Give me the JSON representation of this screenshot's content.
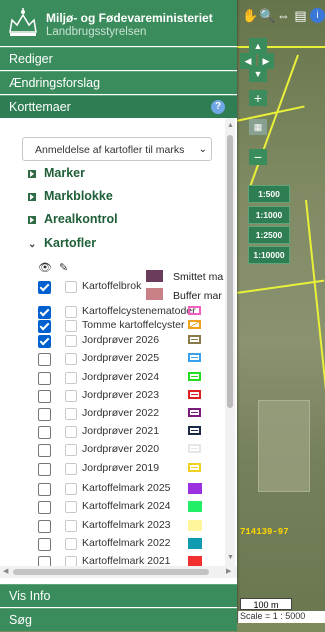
{
  "header": {
    "title": "Miljø- og Fødevareministeriet",
    "subtitle": "Landbrugsstyrelsen"
  },
  "tabs": {
    "rediger": "Rediger",
    "aendringsforslag": "Ændringsforslag",
    "korttemaer": "Korttemaer",
    "vis_info": "Vis Info",
    "soeg": "Søg"
  },
  "help_icon": "?",
  "selector": {
    "value": "Anmeldelse af kartofler til marks"
  },
  "groups": [
    "Marker",
    "Markblokke",
    "Arealkontrol",
    "Kartofler"
  ],
  "legend_popup": [
    {
      "label": "Smittet ma",
      "color": "#6a3d5c"
    },
    {
      "label": "Buffer mar",
      "color": "#c97f86"
    }
  ],
  "layers": [
    {
      "label": "Kartoffelbrok",
      "checked": true,
      "color": "",
      "style": "none"
    },
    {
      "label": "Kartoffelcystenematoder",
      "checked": true,
      "color": "#f25fc0",
      "style": "outline"
    },
    {
      "label": "Tomme kartoffelcyster",
      "checked": true,
      "color": "#f0a020",
      "style": "hatch"
    },
    {
      "label": "Jordprøver 2026",
      "checked": true,
      "color": "#8a7a4a",
      "style": "line"
    },
    {
      "label": "Jordprøver 2025",
      "checked": false,
      "color": "#3aa0f0",
      "style": "line"
    },
    {
      "label": "Jordprøver 2024",
      "checked": false,
      "color": "#22dd22",
      "style": "line"
    },
    {
      "label": "Jordprøver 2023",
      "checked": false,
      "color": "#e02020",
      "style": "line"
    },
    {
      "label": "Jordprøver 2022",
      "checked": false,
      "color": "#7a1a7a",
      "style": "line"
    },
    {
      "label": "Jordprøver 2021",
      "checked": false,
      "color": "#1a2a44",
      "style": "line"
    },
    {
      "label": "Jordprøver 2020",
      "checked": false,
      "color": "#e6e6e6",
      "style": "line"
    },
    {
      "label": "Jordprøver 2019",
      "checked": false,
      "color": "#f0d020",
      "style": "line"
    },
    {
      "label": "Kartoffelmark 2025",
      "checked": false,
      "color": "#9a30e0",
      "style": "fill"
    },
    {
      "label": "Kartoffelmark 2024",
      "checked": false,
      "color": "#22ee66",
      "style": "fill"
    },
    {
      "label": "Kartoffelmark 2023",
      "checked": false,
      "color": "#fff59a",
      "style": "fill"
    },
    {
      "label": "Kartoffelmark 2022",
      "checked": false,
      "color": "#109ab0",
      "style": "fill"
    },
    {
      "label": "Kartoffelmark 2021",
      "checked": false,
      "color": "#f23030",
      "style": "fill"
    }
  ],
  "scale_buttons": [
    "1:500",
    "1:1000",
    "1:2500",
    "1:10000"
  ],
  "coordinate": "714139-97",
  "scalebar": {
    "length": "100 m",
    "ratio": "Scale = 1 : 5000"
  }
}
